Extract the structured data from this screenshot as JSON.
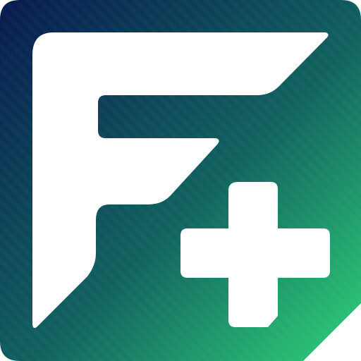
{
  "logo": {
    "name": "F+",
    "glyph_letter": "F",
    "glyph_symbol": "+",
    "colors": {
      "gradient_start": "#071a4f",
      "gradient_mid": "#11625f",
      "gradient_end": "#2ed277",
      "glyph": "#ffffff"
    }
  }
}
